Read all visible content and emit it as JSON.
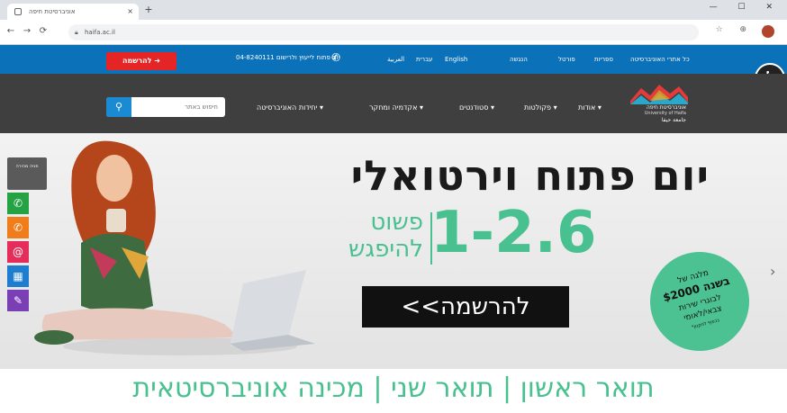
{
  "browser": {
    "tab_title": "אוניברסיטת חיפה",
    "tab_close": "×",
    "new_tab": "+",
    "window_controls": "— ☐ ✕",
    "back": "←",
    "forward": "→",
    "reload": "⟳",
    "url": "haifa.ac.il",
    "toolbar_icons": "☆ ⊕ ☐"
  },
  "topbar": {
    "register_label": "להרשמה",
    "phone_text": "יום פתוח לייעוץ ולרישום 04-8240111",
    "langs": [
      "English",
      "عربية",
      "עברית",
      "العربية"
    ],
    "links": [
      "כל אתרי האוניברסיטה",
      "ספריות",
      "פורטל",
      "הנגשה"
    ]
  },
  "nav": {
    "search_placeholder": "חיפוש באתר",
    "items": [
      "אודות",
      "פקולטות",
      "סטודנטים",
      "אקדמיה ומחקר",
      "יחידות האוניברסיטה"
    ],
    "logo_line1": "אוניברסיטת חיפה",
    "logo_line2": "University of Haifa",
    "logo_line3": "جامعة حيفا"
  },
  "hero": {
    "title": "יום פתוח וירטואלי",
    "dates": "1-2.6",
    "easy_line1": "פשוט",
    "easy_line2": "להיפגש",
    "cta": "<<להרשמה",
    "badge": {
      "line1": "מלגה של",
      "line2": "$2000 בשנה",
      "line3": "לבוגרי שירות",
      "line4": "צבאי/לאומי",
      "line5": "*בכפוף לתקנון"
    },
    "next": "›"
  },
  "side": {
    "header": "פניה מהירה",
    "buttons": [
      {
        "icon": "whatsapp-icon",
        "glyph": "✆",
        "color": "#25a244"
      },
      {
        "icon": "phone-icon",
        "glyph": "✆",
        "color": "#f07d1a"
      },
      {
        "icon": "email-icon",
        "glyph": "@",
        "color": "#e42d5a"
      },
      {
        "icon": "calendar-icon",
        "glyph": "▦",
        "color": "#1d7dd0"
      },
      {
        "icon": "form-icon",
        "glyph": "✎",
        "color": "#7b3fb5"
      }
    ]
  },
  "bottom": {
    "programs": "תואר ראשון | תואר שני | מכינה אוניברסיטאית"
  },
  "colors": {
    "topbar": "#0b71b8",
    "nav": "#3f3f3f",
    "accent_green": "#48c08f",
    "register_red": "#e42425"
  }
}
